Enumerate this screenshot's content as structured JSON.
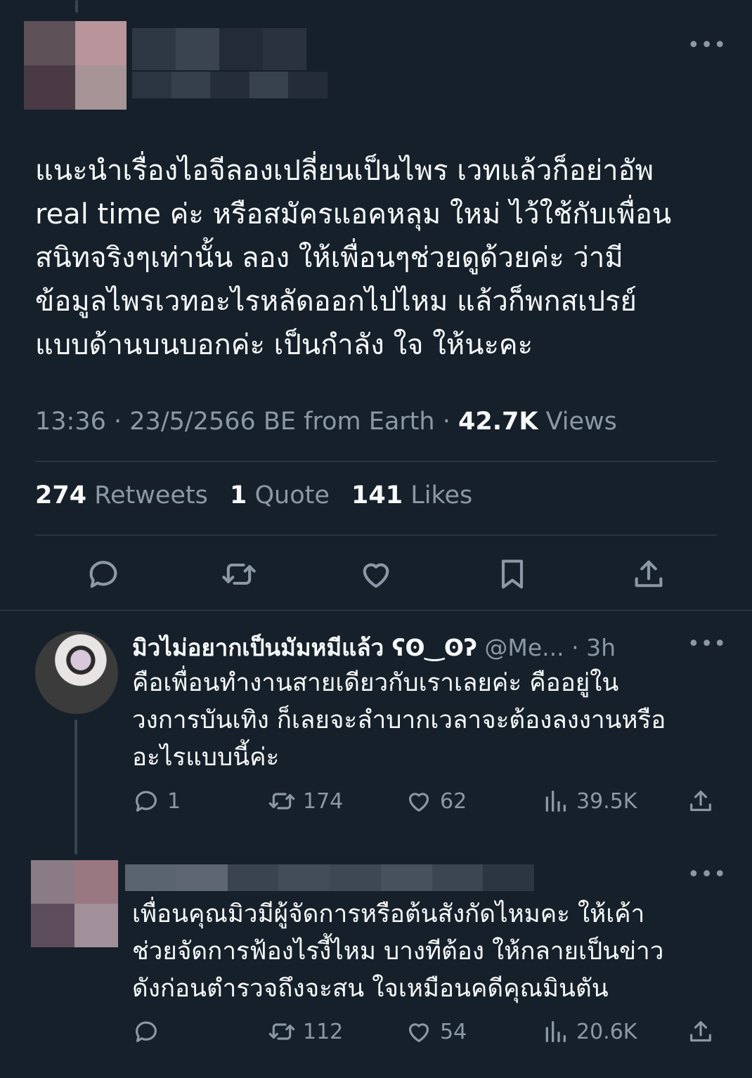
{
  "tweet": {
    "text": "แนะนำเรื่องไอจีลองเปลี่ยนเป็นไพร เวทแล้วก็อย่าอัพ\nreal time ค่ะ หรือสมัครแอคหลุม ใหม่ ไว้ใช้กับเพื่อน\nสนิทจริงๆเท่านั้น ลอง ให้เพื่อนๆช่วยดูด้วยค่ะ ว่ามี\nข้อมูลไพรเวทอะไรหลัดออกไปไหม แล้วก็พกสเปรย์\nแบบด้านบนบอกค่ะ เป็นกำลัง ใจ ให้นะคะ",
    "time": "13:36",
    "date": "23/5/2566 BE",
    "source": "from Earth",
    "views_count": "42.7K",
    "views_label": "Views",
    "retweets_count": "274",
    "retweets_label": "Retweets",
    "quotes_count": "1",
    "quotes_label": "Quote",
    "likes_count": "141",
    "likes_label": "Likes",
    "more_icon": "more-icon"
  },
  "actions": [
    "reply-icon",
    "retweet-icon",
    "like-icon",
    "bookmark-icon",
    "share-icon"
  ],
  "replies": [
    {
      "name": "มิวไม่อยากเป็นมัมหมีแล้ว ʕʘ‿ʘʔ",
      "handle": "@Me...",
      "time": "3h",
      "text": "คือเพื่อนทำงานสายเดียวกับเราเลยค่ะ คืออยู่ใน\nวงการบันเทิง ก็เลยจะลำบากเวลาจะต้องลงงานหรือ\nอะไรแบบนี้ค่ะ",
      "reply_count": "1",
      "retweet_count": "174",
      "like_count": "62",
      "view_count": "39.5K"
    },
    {
      "text": "เพื่อนคุณมิวมีผู้จัดการหรือต้นสังกัดไหมคะ ให้เค้า\nช่วยจัดการฟ้องไรงี้ไหม บางทีต้อง ให้กลายเป็นข่าว\nดังก่อนตำรวจถึงจะสน ใจเหมือนคดีคุณมินตัน",
      "reply_count": "",
      "retweet_count": "112",
      "like_count": "54",
      "view_count": "20.6K"
    }
  ],
  "colors": {
    "background": "#15202b",
    "text": "#f7f9f9",
    "muted": "#8b98a5",
    "divider": "#38444d"
  }
}
